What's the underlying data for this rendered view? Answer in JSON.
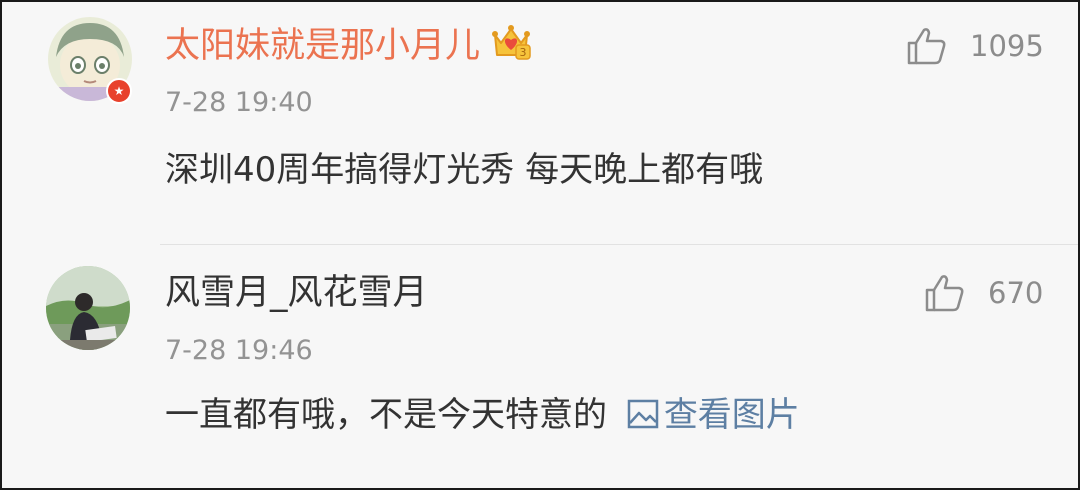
{
  "comments": [
    {
      "username": "太阳妹就是那小月儿",
      "time": "7-28 19:40",
      "text": "深圳40周年搞得灯光秀  每天晚上都有哦",
      "likes": "1095",
      "name_color": "#eb7350",
      "avatar_badge_icon": "star-icon",
      "vip_icon": "crown-icon"
    },
    {
      "username": "风雪月_风花雪月",
      "time": "7-28 19:46",
      "text": "一直都有哦，不是今天特意的",
      "view_image_label": "查看图片",
      "likes": "670",
      "name_color": "#333333"
    }
  ]
}
